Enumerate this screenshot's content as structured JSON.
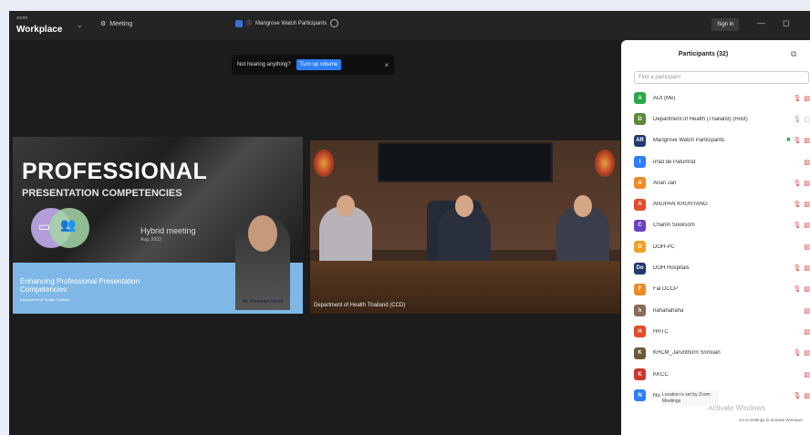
{
  "app": {
    "brand_small": "zoom",
    "brand": "Workplace",
    "meeting_label": "Meeting",
    "window_title": "Mangrove Watch Participants"
  },
  "titlebar": {
    "sign_in": "Sign in",
    "minimize": "—",
    "restore": "◻"
  },
  "notification": {
    "text": "Not hearing anything?",
    "button": "Turn up volume",
    "close": "×"
  },
  "slide": {
    "title": "PROFESSIONAL",
    "subtitle": "PRESENTATION COMPETENCIES",
    "hybrid": "Hybrid meeting",
    "hybrid_sub": "Aug. 2023",
    "bottom_line": "Enhancing Professional Presentation Competencies",
    "bottom_small": "Department of Health Thailand",
    "presenter_name": "Mr. Presenter Name"
  },
  "video": {
    "caption": "Department of Health Thailand (CCD)"
  },
  "participants": {
    "title": "Participants (32)",
    "search_placeholder": "Find a participant",
    "list": [
      {
        "initial": "A",
        "color": "#2aa84a",
        "name": "AOI (Me)",
        "icons": [
          "mic-off",
          "cam-off"
        ]
      },
      {
        "initial": "D",
        "color": "#5a8a3a",
        "name": "Department of Health (Thailand) (Host)",
        "icons": [
          "gray-mic",
          "gray-cam"
        ]
      },
      {
        "initial": "AR",
        "color": "#1e3a6e",
        "name": "Mangrove Watch Participants",
        "icons": [
          "green-sq",
          "mic-off",
          "cam-off"
        ]
      },
      {
        "initial": "I",
        "color": "#2d7ff9",
        "name": "iPad de Patumrat",
        "icons": [
          "cam-off"
        ]
      },
      {
        "initial": "A",
        "color": "#f08a24",
        "name": "Anan Jan",
        "icons": [
          "mic-off",
          "cam-off"
        ]
      },
      {
        "initial": "A",
        "color": "#e34b2b",
        "name": "ANUPAN KHUNYANG",
        "icons": [
          "mic-off",
          "cam-off"
        ]
      },
      {
        "initial": "C",
        "color": "#6a3fc4",
        "name": "Chanin Sooksom",
        "icons": [
          "mic-off",
          "cam-off"
        ]
      },
      {
        "initial": "D",
        "color": "#f0a024",
        "name": "DOH-PC",
        "icons": [
          "cam-off"
        ]
      },
      {
        "initial": "Do",
        "color": "#1e3a6e",
        "name": "DOH Hospitals",
        "icons": [
          "mic-off",
          "cam-off"
        ]
      },
      {
        "initial": "F",
        "color": "#f08a24",
        "name": "Fai DCCP",
        "icons": [
          "mic-off",
          "cam-off"
        ]
      },
      {
        "initial": "h",
        "color": "#8a6a5a",
        "name": "hahahahaha",
        "icons": [
          "cam-off"
        ]
      },
      {
        "initial": "H",
        "color": "#e34b2b",
        "name": "HHTC",
        "icons": [
          "cam-off"
        ]
      },
      {
        "initial": "K",
        "color": "#6a5a3a",
        "name": "KHCM_Jarunthorn Srimuan",
        "icons": [
          "mic-off",
          "cam-off"
        ]
      },
      {
        "initial": "K",
        "color": "#d0342c",
        "name": "KKCC",
        "icons": [
          "cam-off"
        ]
      },
      {
        "initial": "N",
        "color": "#2d7ff9",
        "name": "Nut",
        "icons": [
          "mic-off",
          "cam-off"
        ]
      }
    ]
  },
  "overlays": {
    "tooltip": "Location is set by Zoom Meetings",
    "tooltip2": "Activate Windows · Location is set by Zoom Meetings",
    "watermark": "Activate Windows",
    "watermark_small": "Go to Settings to activate Windows."
  }
}
